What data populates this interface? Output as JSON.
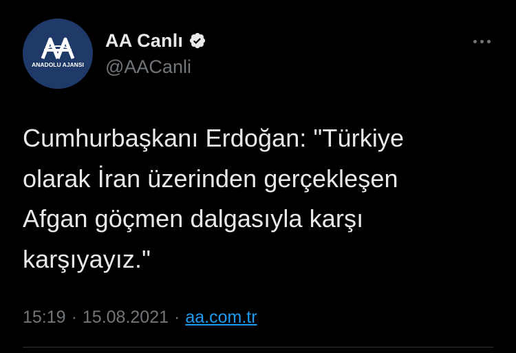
{
  "author": {
    "display_name": "AA Canlı",
    "handle": "@AACanli",
    "verified": true,
    "avatar_text": "ANADOLU AJANSI",
    "avatar_logo_letters": "AA",
    "avatar_bg": "#1f3a68"
  },
  "tweet": {
    "text": "Cumhurbaşkanı Erdoğan: \"Türkiye\nolarak İran üzerinden gerçekleşen\nAfgan göçmen dalgasıyla karşı\nkarşıyayız.\"",
    "time": "15:19",
    "date": "15.08.2021",
    "separator": "·",
    "source": "aa.com.tr"
  },
  "icons": {
    "verified": "verified-badge-icon",
    "more": "more-options-icon"
  },
  "colors": {
    "background": "#000000",
    "primary_text": "#e7e9ea",
    "secondary_text": "#71767b",
    "link": "#1d9bf0",
    "divider": "#2f3336"
  }
}
